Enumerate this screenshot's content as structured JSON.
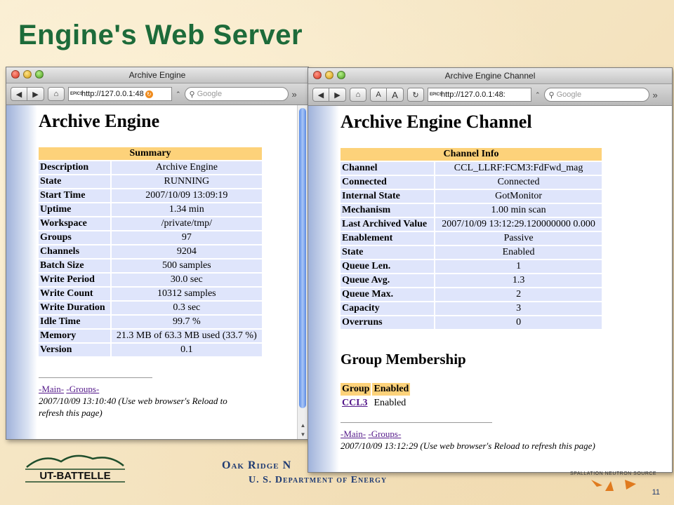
{
  "slide": {
    "title": "Engine's Web Server",
    "org_line1": "Oak Ridge N",
    "org_line2": "U. S. Department of Energy",
    "logo_text": "UT-BATTELLE",
    "sns_text": "SPALLATION NEUTRON SOURCE",
    "page_number": "11"
  },
  "colors": {
    "title_green": "#1d6b3a",
    "header_orange": "#fdd27a",
    "row_blue": "#dfe5fb",
    "org_blue": "#1e3a72"
  },
  "window1": {
    "title": "Archive Engine",
    "url": "http://127.0.0.1:48",
    "search_placeholder": "Google",
    "heading": "Archive Engine",
    "table_header": "Summary",
    "rows": [
      {
        "k": "Description",
        "v": "Archive Engine"
      },
      {
        "k": "State",
        "v": "RUNNING"
      },
      {
        "k": "Start Time",
        "v": "2007/10/09 13:09:19"
      },
      {
        "k": "Uptime",
        "v": "1.34 min"
      },
      {
        "k": "Workspace",
        "v": "/private/tmp/"
      },
      {
        "k": "Groups",
        "v": "97"
      },
      {
        "k": "Channels",
        "v": "9204"
      },
      {
        "k": "Batch Size",
        "v": "500 samples"
      },
      {
        "k": "Write Period",
        "v": "30.0 sec"
      },
      {
        "k": "Write Count",
        "v": "10312 samples"
      },
      {
        "k": "Write Duration",
        "v": "0.3 sec"
      },
      {
        "k": "Idle Time",
        "v": "99.7 %"
      },
      {
        "k": "Memory",
        "v": "21.3 MB of 63.3 MB used (33.7 %)"
      },
      {
        "k": "Version",
        "v": "0.1"
      }
    ],
    "link_main": "-Main-",
    "link_groups": "-Groups-",
    "timestamp": "2007/10/09 13:10:40 (Use web browser's Reload to",
    "timestamp2": "refresh this page)"
  },
  "window2": {
    "title": "Archive Engine Channel",
    "url": "http://127.0.0.1:48:",
    "search_placeholder": "Google",
    "heading": "Archive Engine Channel",
    "table_header": "Channel Info",
    "rows": [
      {
        "k": "Channel",
        "v": "CCL_LLRF:FCM3:FdFwd_mag"
      },
      {
        "k": "Connected",
        "v": "Connected"
      },
      {
        "k": "Internal State",
        "v": "GotMonitor"
      },
      {
        "k": "Mechanism",
        "v": "1.00 min scan"
      },
      {
        "k": "Last Archived Value",
        "v": "2007/10/09 13:12:29.120000000 0.000"
      },
      {
        "k": "Enablement",
        "v": "Passive"
      },
      {
        "k": "State",
        "v": "Enabled"
      },
      {
        "k": "Queue Len.",
        "v": "1"
      },
      {
        "k": "Queue Avg.",
        "v": "1.3"
      },
      {
        "k": "Queue Max.",
        "v": "2"
      },
      {
        "k": "Capacity",
        "v": "3"
      },
      {
        "k": "Overruns",
        "v": "0"
      }
    ],
    "group_heading": "Group Membership",
    "group_col1": "Group",
    "group_col2": "Enabled",
    "group_name": "CCL3",
    "group_enabled": "Enabled",
    "link_main": "-Main-",
    "link_groups": "-Groups-",
    "timestamp": "2007/10/09 13:12:29 (Use web browser's Reload to refresh this page)"
  }
}
